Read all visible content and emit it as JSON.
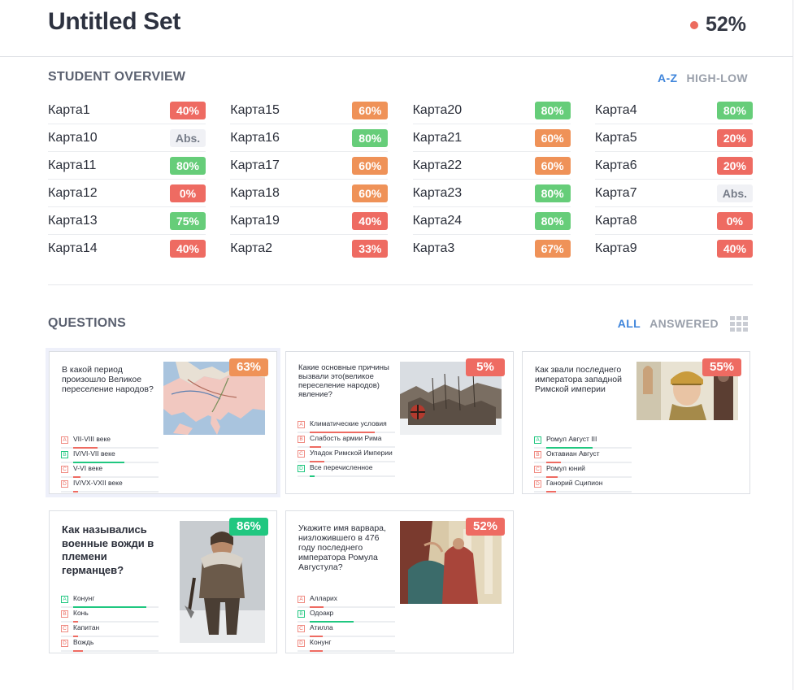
{
  "header": {
    "title": "Untitled Set",
    "overall_score": "52%"
  },
  "student_overview": {
    "title": "STUDENT OVERVIEW",
    "sort_az": "A-Z",
    "sort_highlow": "HIGH-LOW",
    "columns": [
      [
        {
          "name": "Карта1",
          "score": "40%",
          "status": "red"
        },
        {
          "name": "Карта10",
          "score": "Abs.",
          "status": "abs"
        },
        {
          "name": "Карта11",
          "score": "80%",
          "status": "green"
        },
        {
          "name": "Карта12",
          "score": "0%",
          "status": "red"
        },
        {
          "name": "Карта13",
          "score": "75%",
          "status": "green"
        },
        {
          "name": "Карта14",
          "score": "40%",
          "status": "red"
        }
      ],
      [
        {
          "name": "Карта15",
          "score": "60%",
          "status": "orange"
        },
        {
          "name": "Карта16",
          "score": "80%",
          "status": "green"
        },
        {
          "name": "Карта17",
          "score": "60%",
          "status": "orange"
        },
        {
          "name": "Карта18",
          "score": "60%",
          "status": "orange"
        },
        {
          "name": "Карта19",
          "score": "40%",
          "status": "red"
        },
        {
          "name": "Карта2",
          "score": "33%",
          "status": "red"
        }
      ],
      [
        {
          "name": "Карта20",
          "score": "80%",
          "status": "green"
        },
        {
          "name": "Карта21",
          "score": "60%",
          "status": "orange"
        },
        {
          "name": "Карта22",
          "score": "60%",
          "status": "orange"
        },
        {
          "name": "Карта23",
          "score": "80%",
          "status": "green"
        },
        {
          "name": "Карта24",
          "score": "80%",
          "status": "green"
        },
        {
          "name": "Карта3",
          "score": "67%",
          "status": "orange"
        }
      ],
      [
        {
          "name": "Карта4",
          "score": "80%",
          "status": "green"
        },
        {
          "name": "Карта5",
          "score": "20%",
          "status": "red"
        },
        {
          "name": "Карта6",
          "score": "20%",
          "status": "red"
        },
        {
          "name": "Карта7",
          "score": "Abs.",
          "status": "abs"
        },
        {
          "name": "Карта8",
          "score": "0%",
          "status": "red"
        },
        {
          "name": "Карта9",
          "score": "40%",
          "status": "red"
        }
      ]
    ]
  },
  "questions": {
    "title": "QUESTIONS",
    "filter_all": "ALL",
    "filter_answered": "ANSWERED",
    "items": [
      {
        "text": "В какой период произошло Великое переселение народов?",
        "score": "63%",
        "score_color": "orange",
        "image": "map-image",
        "answers": [
          {
            "letter": "A",
            "text": "VII-VIII веке",
            "correct": false,
            "share": 0.25
          },
          {
            "letter": "B",
            "text": "IV/VI-VII веке",
            "correct": true,
            "share": 0.55
          },
          {
            "letter": "C",
            "text": "V-VI веке",
            "correct": false,
            "share": 0.08
          },
          {
            "letter": "D",
            "text": "IV/VX-VXII веке",
            "correct": false,
            "share": 0.05
          }
        ]
      },
      {
        "text": "Какие основные причины вызвали это(великое переселение народов) явление?",
        "score": "5%",
        "score_color": "red",
        "image": "battle-image",
        "answers": [
          {
            "letter": "A",
            "text": "Климатические условия",
            "correct": false,
            "share": 0.7
          },
          {
            "letter": "B",
            "text": "Слабость армии Рима",
            "correct": false,
            "share": 0.12
          },
          {
            "letter": "C",
            "text": "Упадок Римской Империи",
            "correct": false,
            "share": 0.15
          },
          {
            "letter": "D",
            "text": "Все перечисленное",
            "correct": true,
            "share": 0.05
          }
        ]
      },
      {
        "text": "Как звали последнего императора западной Римской империи",
        "score": "55%",
        "score_color": "red",
        "image": "emperor-image",
        "answers": [
          {
            "letter": "A",
            "text": "Ромул Август III",
            "correct": true,
            "share": 0.5
          },
          {
            "letter": "B",
            "text": "Октавиан Август",
            "correct": false,
            "share": 0.15
          },
          {
            "letter": "C",
            "text": "Ромул юний",
            "correct": false,
            "share": 0.12
          },
          {
            "letter": "D",
            "text": "Ганорий Сципион",
            "correct": false,
            "share": 0.1
          }
        ]
      },
      {
        "text": "Как назывались военные вожди в племени германцев?",
        "score": "86%",
        "score_color": "green",
        "image": "warrior-image",
        "answers": [
          {
            "letter": "A",
            "text": "Конунг",
            "correct": true,
            "share": 0.85
          },
          {
            "letter": "B",
            "text": "Конь",
            "correct": false,
            "share": 0.06
          },
          {
            "letter": "C",
            "text": "Капитан",
            "correct": false,
            "share": 0.06
          },
          {
            "letter": "D",
            "text": "Вождь",
            "correct": false,
            "share": 0.1
          }
        ]
      },
      {
        "text": "Укажите имя варвара, низложившего в 476 году последнего императора Ромула Августула?",
        "score": "52%",
        "score_color": "red",
        "image": "painting-image",
        "answers": [
          {
            "letter": "A",
            "text": "Алларих",
            "correct": false,
            "share": 0.15
          },
          {
            "letter": "B",
            "text": "Одоакр",
            "correct": true,
            "share": 0.52
          },
          {
            "letter": "C",
            "text": "Атилла",
            "correct": false,
            "share": 0.14
          },
          {
            "letter": "D",
            "text": "Конунг",
            "correct": false,
            "share": 0.14
          }
        ]
      }
    ]
  },
  "colors": {
    "red": "#ee6b62",
    "orange": "#ef9258",
    "green": "#66cd79",
    "answer_green": "#20c780",
    "accent_blue": "#3f85db"
  }
}
